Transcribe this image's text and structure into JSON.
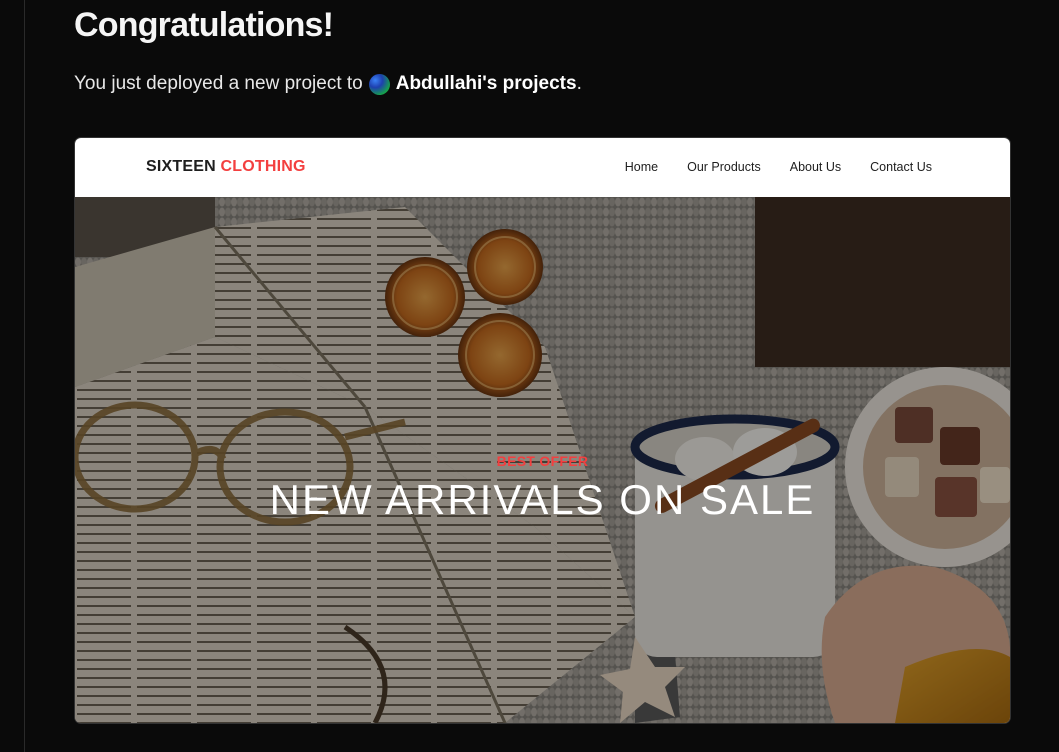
{
  "page": {
    "heading": "Congratulations!",
    "subline_prefix": "You just deployed a new project to",
    "team_name": "Abdullahi's projects",
    "subline_suffix": "."
  },
  "preview": {
    "brand": {
      "primary": "SIXTEEN",
      "accent": "CLOTHING",
      "accent_color": "#f33f3f"
    },
    "nav": [
      {
        "label": "Home"
      },
      {
        "label": "Our Products"
      },
      {
        "label": "About Us"
      },
      {
        "label": "Contact Us"
      }
    ],
    "hero": {
      "eyebrow": "BEST OFFER",
      "title": "NEW ARRIVALS ON SALE",
      "image": "cozy-book-cocoa-photo"
    }
  }
}
